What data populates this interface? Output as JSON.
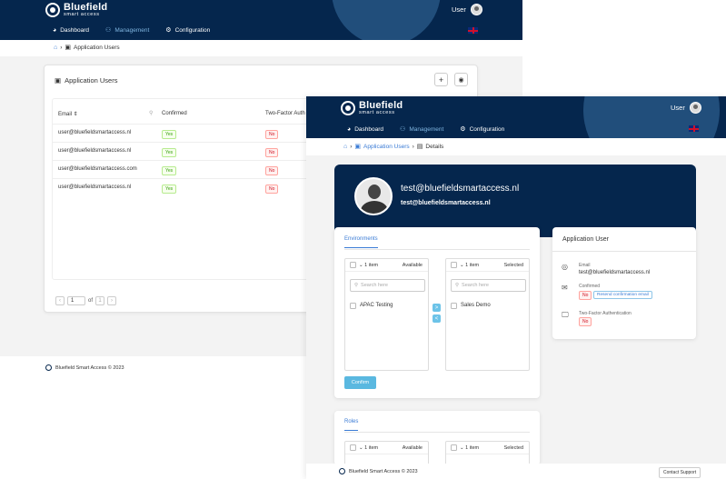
{
  "brand": {
    "name": "Bluefield",
    "sub": "smart access"
  },
  "nav": {
    "dashboard": "Dashboard",
    "management": "Management",
    "configuration": "Configuration",
    "user": "User"
  },
  "back": {
    "breadcrumb": {
      "current": "Application Users"
    },
    "card_title": "Application Users",
    "columns": {
      "email": "Email",
      "confirmed": "Confirmed",
      "two_factor": "Two-Factor Auth"
    },
    "rows": [
      {
        "email": "user@bluefieldsmartaccess.nl",
        "confirmed": "Yes",
        "two_factor": "No"
      },
      {
        "email": "user@bluefieldsmartaccess.nl",
        "confirmed": "Yes",
        "two_factor": "No"
      },
      {
        "email": "user@bluefieldsmartaccess.com",
        "confirmed": "Yes",
        "two_factor": "No"
      },
      {
        "email": "user@bluefieldsmartaccess.nl",
        "confirmed": "Yes",
        "two_factor": "No"
      }
    ],
    "pager": {
      "page": "1",
      "of": "of",
      "total": "1"
    },
    "footer": "Bluefield Smart Access © 2023"
  },
  "front": {
    "breadcrumb": {
      "parent": "Application Users",
      "current": "Details"
    },
    "profile": {
      "name": "test@bluefieldsmartaccess.nl",
      "email": "test@bluefieldsmartaccess.nl"
    },
    "environments": {
      "tab": "Environments",
      "available": {
        "count": "1 item",
        "title": "Available",
        "placeholder": "Search here",
        "items": [
          "APAC Testing"
        ]
      },
      "selected": {
        "count": "1 item",
        "title": "Selected",
        "placeholder": "Search here",
        "items": [
          "Sales Demo"
        ]
      },
      "move_right": ">",
      "move_left": "<",
      "confirm": "Confirm"
    },
    "roles": {
      "tab": "Roles",
      "available": {
        "count": "1 item",
        "title": "Available"
      },
      "selected": {
        "count": "1 item",
        "title": "Selected"
      }
    },
    "app_user": {
      "title": "Application User",
      "email_label": "Email",
      "email_value": "test@bluefieldsmartaccess.nl",
      "confirmed_label": "Confirmed",
      "confirmed_value": "No",
      "resend": "Resend confirmation email",
      "two_factor_label": "Two-Factor Authentication",
      "two_factor_value": "No"
    },
    "footer": "Bluefield Smart Access © 2023",
    "contact": "Contact Support"
  }
}
